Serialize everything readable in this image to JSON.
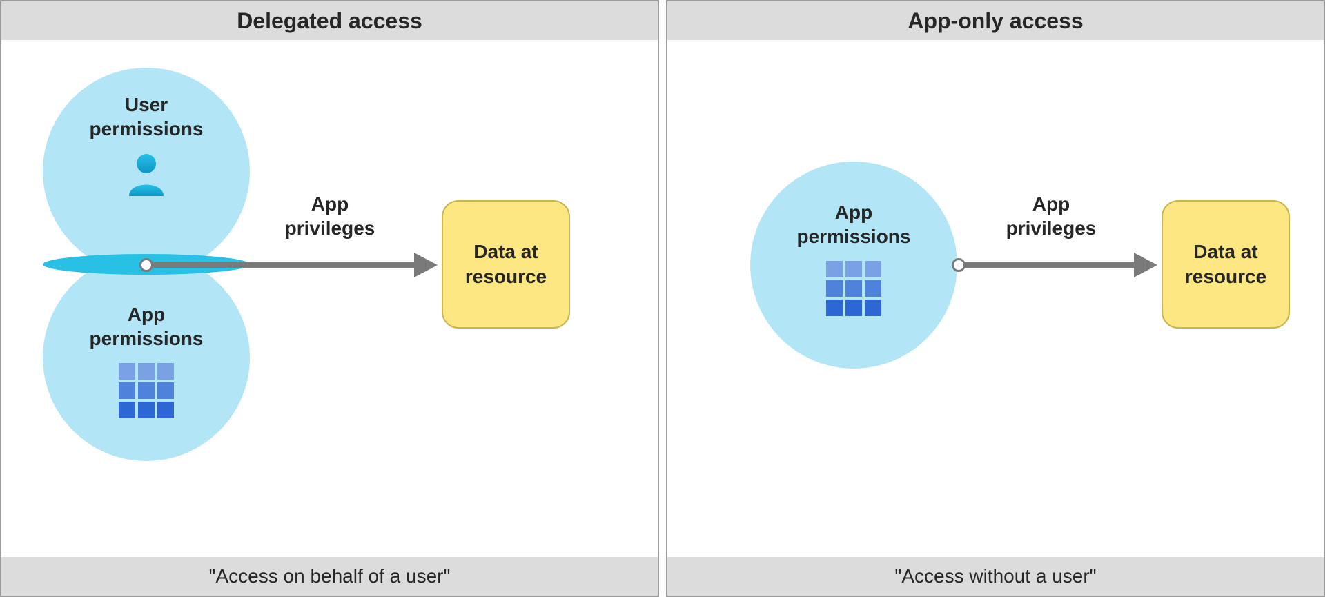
{
  "left": {
    "title": "Delegated access",
    "caption": "\"Access on behalf of a user\"",
    "user_perm_label": "User\npermissions",
    "app_perm_label": "App\npermissions",
    "arrow_label": "App\nprivileges",
    "data_box": "Data at\nresource"
  },
  "right": {
    "title": "App-only access",
    "caption": "\"Access without a user\"",
    "app_perm_label": "App\npermissions",
    "arrow_label": "App\nprivileges",
    "data_box": "Data at\nresource"
  },
  "icons": {
    "user": "user-icon",
    "app_grid": "app-grid-icon"
  },
  "colors": {
    "panel_header_bg": "#dcdcdc",
    "circle_bg": "#b2e5f5",
    "intersection_bg": "#28c0e5",
    "databox_bg": "#fce783",
    "arrow": "#7a7a7a"
  }
}
